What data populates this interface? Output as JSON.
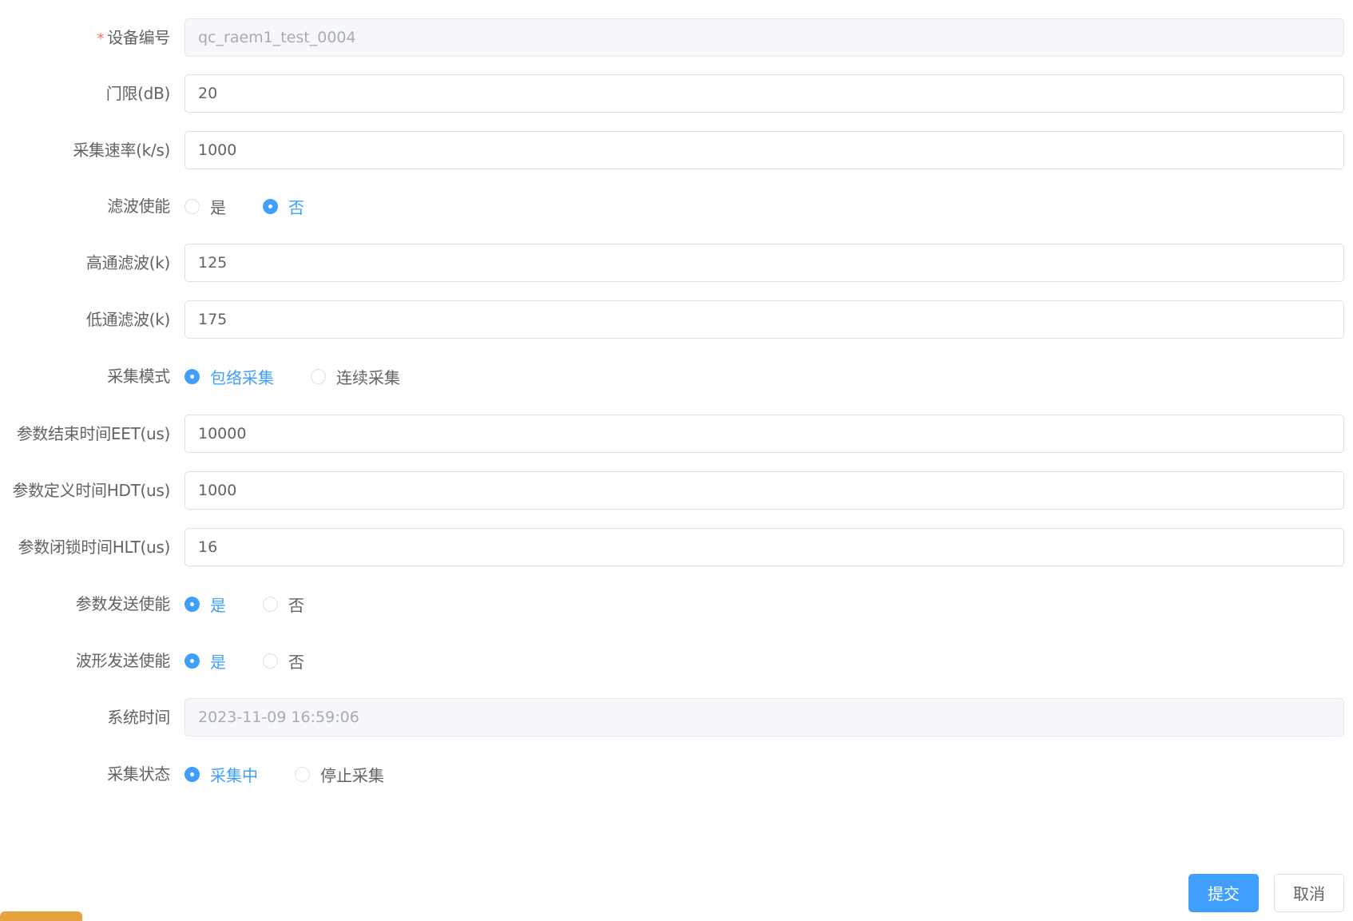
{
  "form": {
    "device_id": {
      "label": "设备编号",
      "required_mark": "*",
      "value": "qc_raem1_test_0004"
    },
    "threshold": {
      "label": "门限(dB)",
      "value": "20"
    },
    "sample_rate": {
      "label": "采集速率(k/s)",
      "value": "1000"
    },
    "filter_enable": {
      "label": "滤波使能",
      "options": [
        "是",
        "否"
      ],
      "selected": "否"
    },
    "high_pass": {
      "label": "高通滤波(k)",
      "value": "125"
    },
    "low_pass": {
      "label": "低通滤波(k)",
      "value": "175"
    },
    "capture_mode": {
      "label": "采集模式",
      "options": [
        "包络采集",
        "连续采集"
      ],
      "selected": "包络采集"
    },
    "eet": {
      "label": "参数结束时间EET(us)",
      "value": "10000"
    },
    "hdt": {
      "label": "参数定义时间HDT(us)",
      "value": "1000"
    },
    "hlt": {
      "label": "参数闭锁时间HLT(us)",
      "value": "16"
    },
    "param_send_enable": {
      "label": "参数发送使能",
      "options": [
        "是",
        "否"
      ],
      "selected": "是"
    },
    "wave_send_enable": {
      "label": "波形发送使能",
      "options": [
        "是",
        "否"
      ],
      "selected": "是"
    },
    "system_time": {
      "label": "系统时间",
      "value": "2023-11-09 16:59:06"
    },
    "capture_status": {
      "label": "采集状态",
      "options": [
        "采集中",
        "停止采集"
      ],
      "selected": "采集中"
    }
  },
  "actions": {
    "submit_label": "提交",
    "cancel_label": "取消"
  },
  "colors": {
    "primary": "#409eff",
    "required": "#f56c6c",
    "text": "#606266",
    "border": "#dcdfe6",
    "disabled_bg": "#f5f7fa",
    "accent_tab": "#e6a23c"
  }
}
